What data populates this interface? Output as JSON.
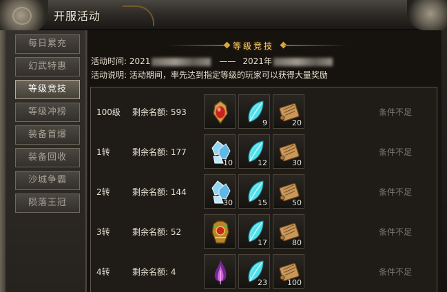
{
  "window": {
    "title": "开服活动"
  },
  "sidebar": {
    "items": [
      {
        "label": "每日累充",
        "active": false
      },
      {
        "label": "幻武特惠",
        "active": false
      },
      {
        "label": "等级竞技",
        "active": true
      },
      {
        "label": "等级冲榜",
        "active": false
      },
      {
        "label": "装备首爆",
        "active": false
      },
      {
        "label": "装备回收",
        "active": false
      },
      {
        "label": "沙城争霸",
        "active": false
      },
      {
        "label": "陨落王冠",
        "active": false
      }
    ]
  },
  "panel": {
    "header": "等级竞技",
    "time_label": "活动时间: 2021",
    "time_sep": "——",
    "time_end": "2021年",
    "desc": "活动说明: 活动期间，率先达到指定等级的玩家可以获得大量奖励"
  },
  "rows": [
    {
      "level": "100级",
      "quota": "剩余名额: 593",
      "rewards": [
        {
          "icon": "red-gem-amulet-icon",
          "count": ""
        },
        {
          "icon": "cyan-feather-icon",
          "count": "9"
        },
        {
          "icon": "scroll-icon",
          "count": "20"
        }
      ],
      "status": "条件不足"
    },
    {
      "level": "1转",
      "quota": "剩余名额: 177",
      "rewards": [
        {
          "icon": "ice-crystal-icon",
          "count": "10"
        },
        {
          "icon": "cyan-feather-icon",
          "count": "12"
        },
        {
          "icon": "scroll-icon",
          "count": "30"
        }
      ],
      "status": "条件不足"
    },
    {
      "level": "2转",
      "quota": "剩余名额: 144",
      "rewards": [
        {
          "icon": "ice-crystal-icon",
          "count": "30"
        },
        {
          "icon": "cyan-feather-icon",
          "count": "15"
        },
        {
          "icon": "scroll-icon",
          "count": "50"
        }
      ],
      "status": "条件不足"
    },
    {
      "level": "3转",
      "quota": "剩余名额: 52",
      "rewards": [
        {
          "icon": "golden-armor-icon",
          "count": ""
        },
        {
          "icon": "cyan-feather-icon",
          "count": "17"
        },
        {
          "icon": "scroll-icon",
          "count": "80"
        }
      ],
      "status": "条件不足"
    },
    {
      "level": "4转",
      "quota": "剩余名额: 4",
      "rewards": [
        {
          "icon": "purple-flame-icon",
          "count": ""
        },
        {
          "icon": "cyan-feather-icon",
          "count": "23"
        },
        {
          "icon": "scroll-icon",
          "count": "100"
        }
      ],
      "status": "条件不足"
    }
  ],
  "colors": {
    "accent_gold": "#f0c96a",
    "text": "#e8e1d1",
    "muted": "#7e7a72"
  }
}
